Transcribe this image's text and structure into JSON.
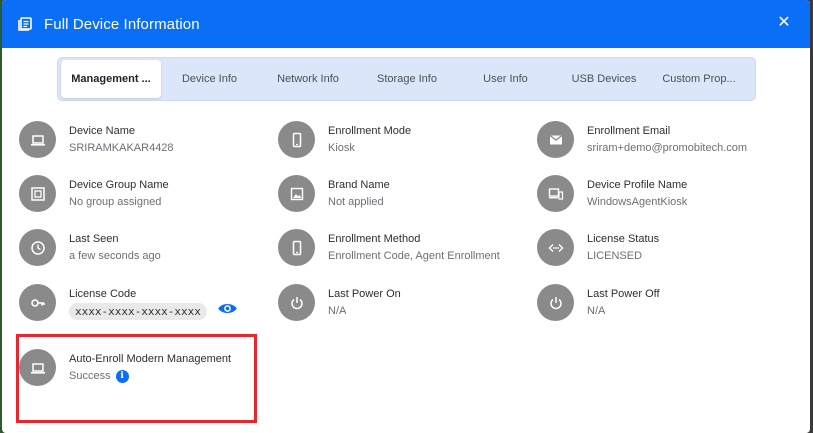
{
  "dialog": {
    "title": "Full Device Information",
    "close_label": "✕"
  },
  "tabs": [
    {
      "label": "Management ...",
      "active": true
    },
    {
      "label": "Device Info",
      "active": false
    },
    {
      "label": "Network Info",
      "active": false
    },
    {
      "label": "Storage Info",
      "active": false
    },
    {
      "label": "User Info",
      "active": false
    },
    {
      "label": "USB Devices",
      "active": false
    },
    {
      "label": "Custom Prop...",
      "active": false
    }
  ],
  "fields": {
    "device_name": {
      "label": "Device Name",
      "value": "SRIRAMKAKAR4428",
      "icon": "laptop-icon"
    },
    "enrollment_mode": {
      "label": "Enrollment Mode",
      "value": "Kiosk",
      "icon": "phone-icon"
    },
    "enrollment_email": {
      "label": "Enrollment Email",
      "value": "sriram+demo@promobitech.com",
      "icon": "mail-icon"
    },
    "device_group_name": {
      "label": "Device Group Name",
      "value": "No group assigned",
      "icon": "group-icon"
    },
    "brand_name": {
      "label": "Brand Name",
      "value": "Not applied",
      "icon": "image-icon"
    },
    "device_profile_name": {
      "label": "Device Profile Name",
      "value": "WindowsAgentKiosk",
      "icon": "devices-icon"
    },
    "last_seen": {
      "label": "Last Seen",
      "value": "a few seconds ago",
      "icon": "clock-icon"
    },
    "enrollment_method": {
      "label": "Enrollment Method",
      "value": "Enrollment Code, Agent Enrollment",
      "icon": "phone-icon"
    },
    "license_status": {
      "label": "License Status",
      "value": "LICENSED",
      "icon": "code-icon"
    },
    "license_code": {
      "label": "License Code",
      "value": "xxxx-xxxx-xxxx-xxxx",
      "icon": "key-icon"
    },
    "last_power_on": {
      "label": "Last Power On",
      "value": "N/A",
      "icon": "power-icon"
    },
    "last_power_off": {
      "label": "Last Power Off",
      "value": "N/A",
      "icon": "power-icon"
    },
    "auto_enroll": {
      "label": "Auto-Enroll Modern Management",
      "value": "Success",
      "icon": "laptop-icon",
      "info_label": "i"
    }
  },
  "colors": {
    "header": "#0b6ef6",
    "avatar": "#8a8a8a",
    "highlight": "#e8262b",
    "tabs_bg": "#dce6fa"
  }
}
